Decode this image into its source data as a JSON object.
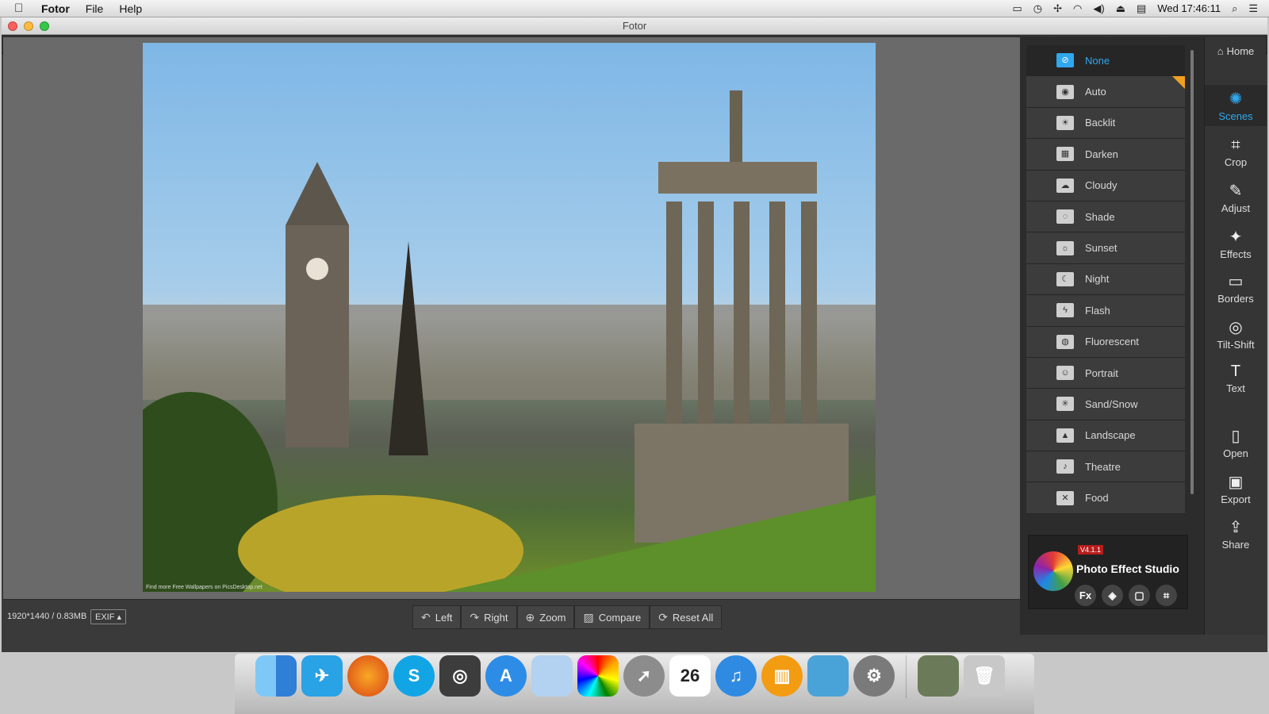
{
  "menubar": {
    "app_name": "Fotor",
    "menus": [
      "File",
      "Help"
    ],
    "clock": "Wed 17:46:11"
  },
  "window": {
    "title": "Fotor"
  },
  "photo": {
    "caption": "Find more Free Wallpapers on PicsDesktop.net"
  },
  "bottombar": {
    "image_info": "1920*1440 / 0.83MB",
    "exif_label": "EXIF",
    "tools": [
      {
        "label": "Left",
        "icon": "rotate-left-icon"
      },
      {
        "label": "Right",
        "icon": "rotate-right-icon"
      },
      {
        "label": "Zoom",
        "icon": "zoom-icon"
      },
      {
        "label": "Compare",
        "icon": "compare-icon"
      },
      {
        "label": "Reset All",
        "icon": "reset-icon"
      }
    ]
  },
  "scenes": [
    {
      "label": "None",
      "selected": true
    },
    {
      "label": "Auto"
    },
    {
      "label": "Backlit"
    },
    {
      "label": "Darken"
    },
    {
      "label": "Cloudy"
    },
    {
      "label": "Shade"
    },
    {
      "label": "Sunset"
    },
    {
      "label": "Night"
    },
    {
      "label": "Flash"
    },
    {
      "label": "Fluorescent"
    },
    {
      "label": "Portrait"
    },
    {
      "label": "Sand/Snow"
    },
    {
      "label": "Landscape"
    },
    {
      "label": "Theatre"
    },
    {
      "label": "Food"
    }
  ],
  "promo": {
    "version": "V4.1.1",
    "title": "Photo Effect Studio",
    "icons": [
      "Fx",
      "◈",
      "▢",
      "⌗"
    ]
  },
  "nav": {
    "home": "Home",
    "items": [
      "Scenes",
      "Crop",
      "Adjust",
      "Effects",
      "Borders",
      "Tilt-Shift",
      "Text"
    ],
    "file_items": [
      "Open",
      "Export",
      "Share"
    ]
  },
  "dock": {
    "date_badge": "26",
    "apps": [
      "finder",
      "twitter",
      "firefox",
      "skype",
      "steam",
      "app-store",
      "preview",
      "photo-color",
      "launchpad",
      "calendar",
      "itunes",
      "ibooks",
      "iphoto",
      "system-preferences"
    ]
  },
  "colors": {
    "accent": "#2fa8ee",
    "panel_bg": "#2c2c2c",
    "badge": "#f0a021"
  }
}
